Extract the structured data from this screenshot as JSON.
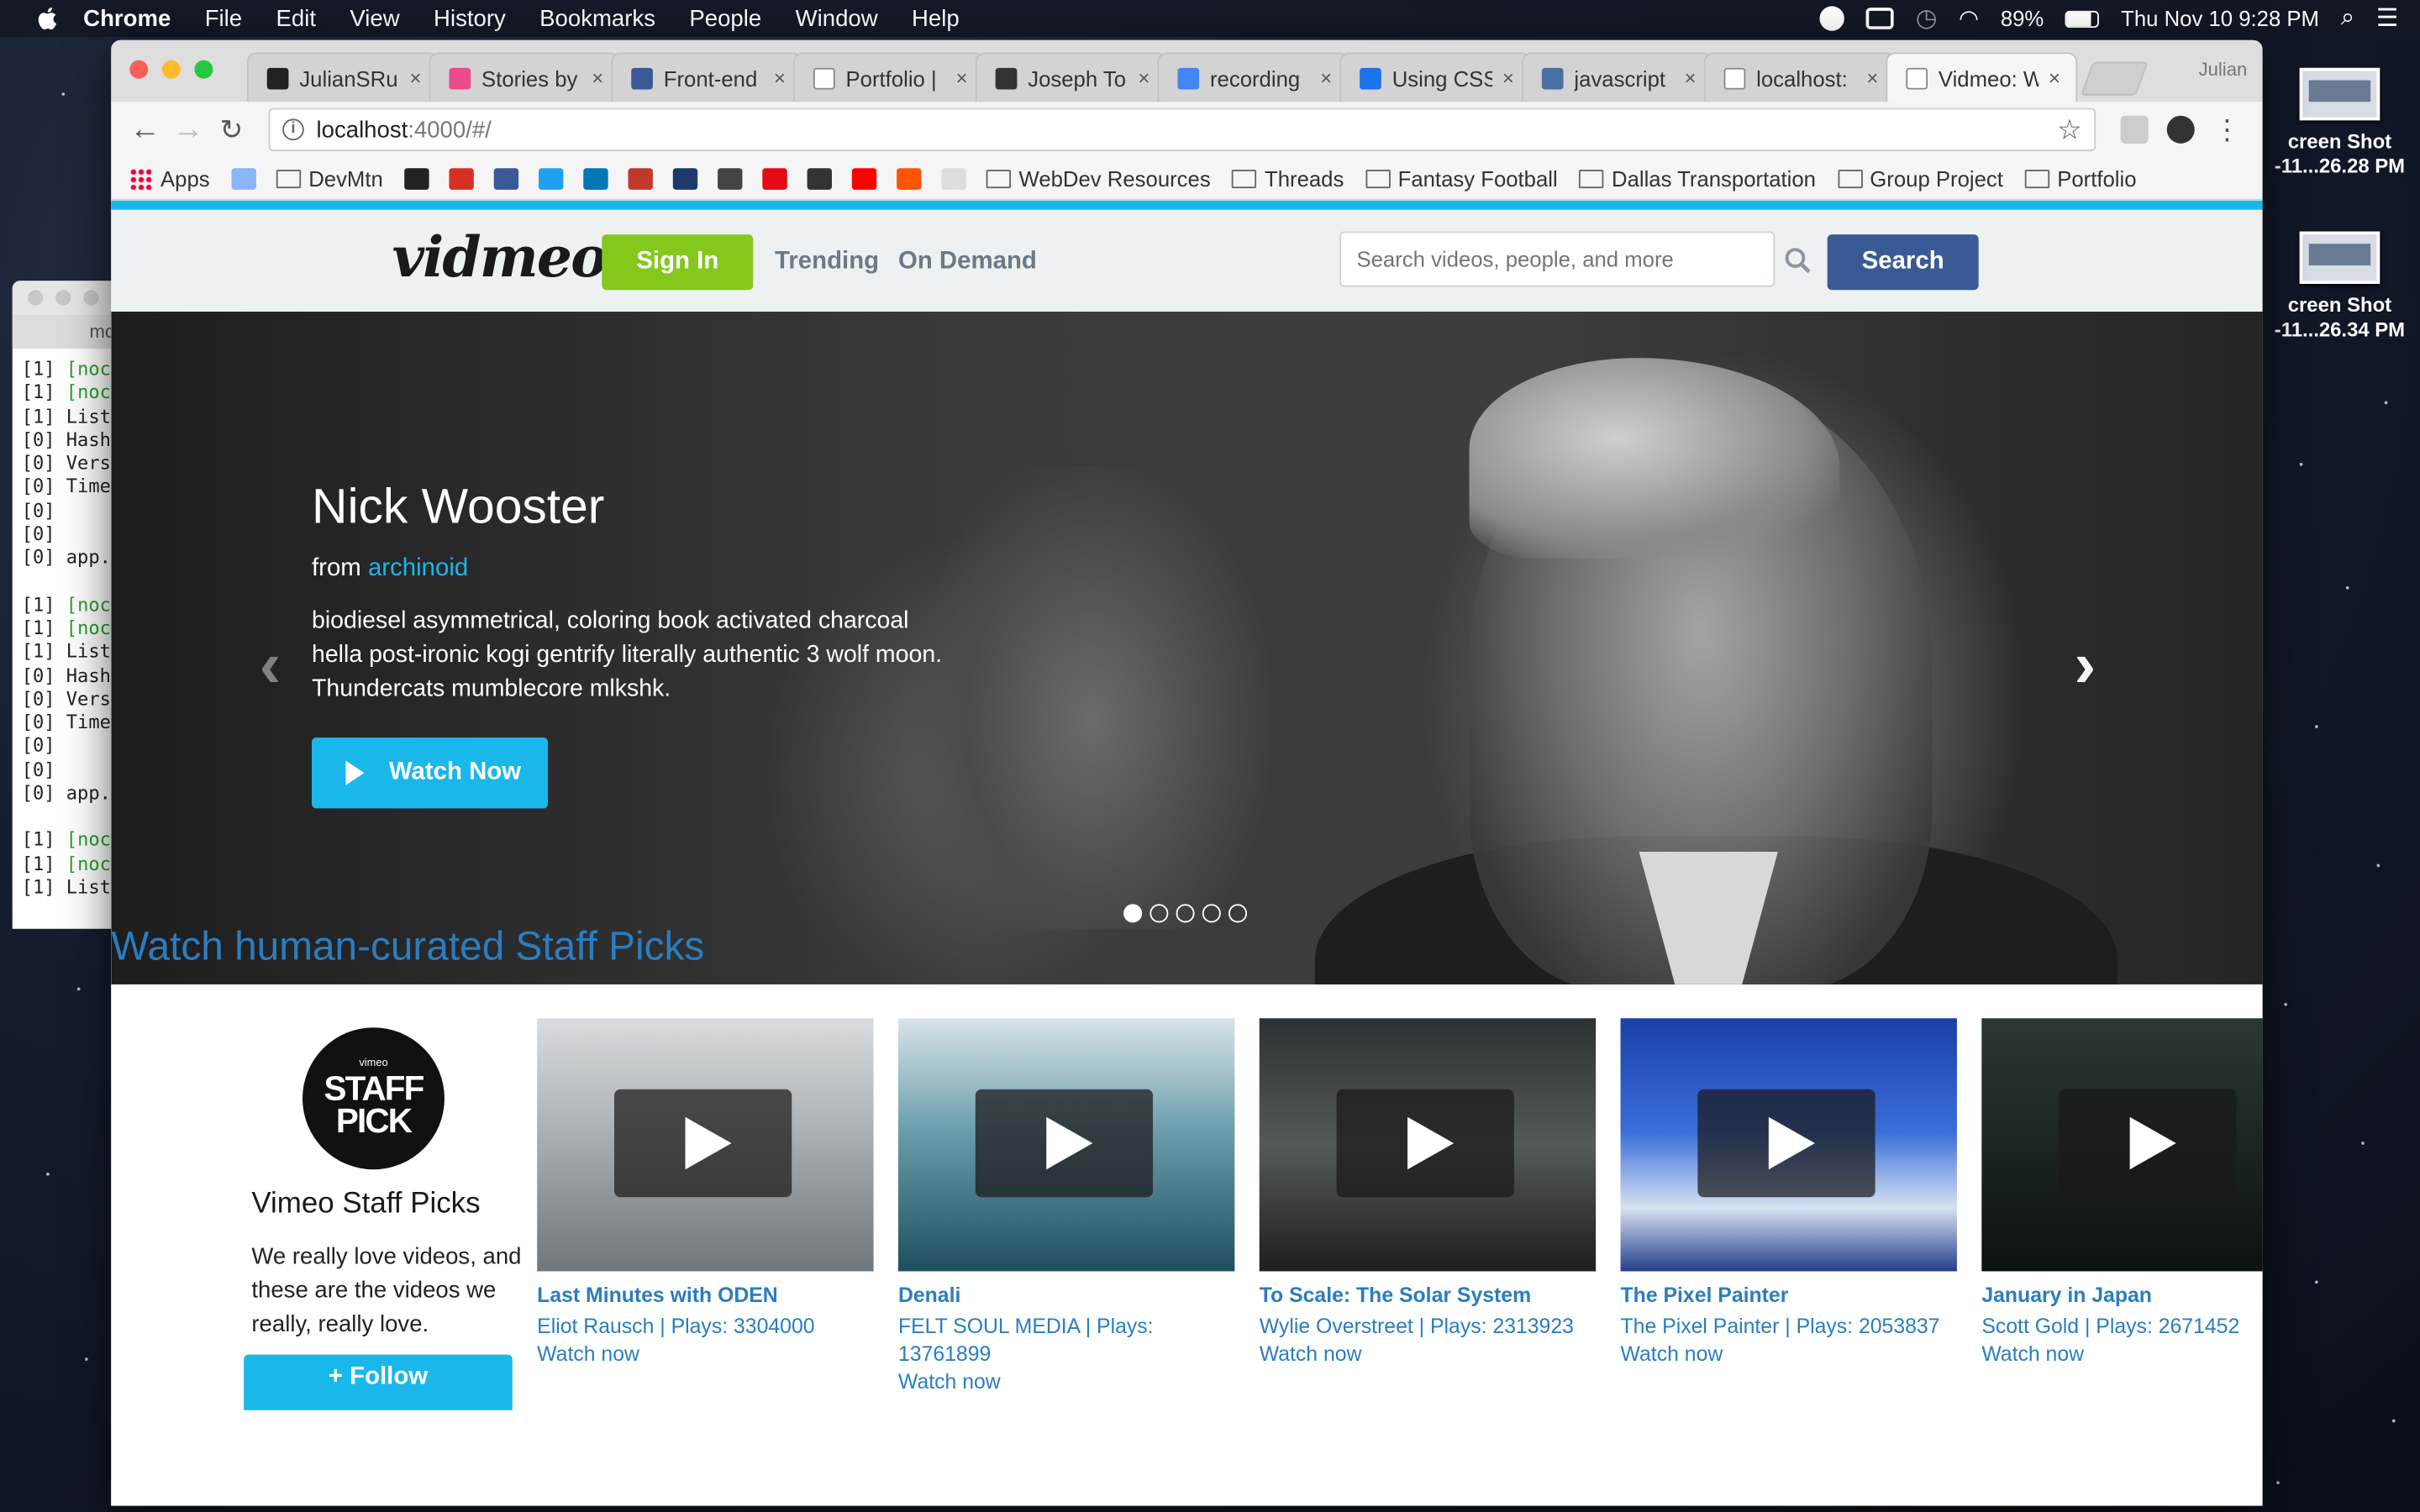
{
  "menubar": {
    "app": "Chrome",
    "items": [
      "File",
      "Edit",
      "View",
      "History",
      "Bookmarks",
      "People",
      "Window",
      "Help"
    ],
    "battery": "89%",
    "datetime": "Thu Nov 10  9:28 PM"
  },
  "desktop": {
    "icons": [
      {
        "line1": "creen Shot",
        "line2": "-11...26.28 PM"
      },
      {
        "line1": "creen Shot",
        "line2": "-11...26.34 PM"
      }
    ]
  },
  "terminal": {
    "tab": "mo",
    "lines": [
      {
        "t": "[1] ",
        "g": "[noc"
      },
      {
        "t": "[1] ",
        "g": "[noc"
      },
      {
        "t": "[1] List",
        "g": ""
      },
      {
        "t": "[0] Hash",
        "g": ""
      },
      {
        "t": "[0] Vers",
        "g": ""
      },
      {
        "t": "[0] Time",
        "g": ""
      },
      {
        "t": "[0]",
        "g": ""
      },
      {
        "t": "[0]",
        "g": ""
      },
      {
        "t": "[0] app.",
        "g": ""
      },
      {
        "t": "",
        "g": ""
      },
      {
        "t": "[1] ",
        "g": "[noc"
      },
      {
        "t": "[1] ",
        "g": "[noc"
      },
      {
        "t": "[1] List",
        "g": ""
      },
      {
        "t": "[0] Hash",
        "g": ""
      },
      {
        "t": "[0] Vers",
        "g": ""
      },
      {
        "t": "[0] Time",
        "g": ""
      },
      {
        "t": "[0]",
        "g": ""
      },
      {
        "t": "[0]",
        "g": ""
      },
      {
        "t": "[0] app.",
        "g": ""
      },
      {
        "t": "",
        "g": ""
      },
      {
        "t": "[1] ",
        "g": "[noc"
      },
      {
        "t": "[1] ",
        "g": "[noc"
      },
      {
        "t": "[1] List",
        "g": ""
      }
    ]
  },
  "browser": {
    "tabs": [
      {
        "title": "JulianSRu",
        "color": "#222222",
        "active": false
      },
      {
        "title": "Stories by",
        "color": "#ea4c89",
        "active": false
      },
      {
        "title": "Front-end",
        "color": "#3b5998",
        "active": false
      },
      {
        "title": "Portfolio |",
        "color": "#ffffff",
        "active": false
      },
      {
        "title": "Joseph To",
        "color": "#333333",
        "active": false
      },
      {
        "title": "recording",
        "color": "#4285f4",
        "active": false
      },
      {
        "title": "Using CSS",
        "color": "#1a73e8",
        "active": false
      },
      {
        "title": "javascript",
        "color": "#4a6fa5",
        "active": false
      },
      {
        "title": "localhost:",
        "color": "#ffffff",
        "active": false
      },
      {
        "title": "Vidmeo: W",
        "color": "#ffffff",
        "active": true
      }
    ],
    "profile": "Julian",
    "url_host": "localhost",
    "url_path": ":4000/#/",
    "bookmarks": [
      {
        "label": "Apps",
        "kind": "apps"
      },
      {
        "label": "",
        "kind": "icon",
        "color": "#8ab4f8"
      },
      {
        "label": "DevMtn",
        "kind": "folder"
      },
      {
        "label": "",
        "kind": "icon",
        "color": "#222222"
      },
      {
        "label": "",
        "kind": "icon",
        "color": "#d93025"
      },
      {
        "label": "",
        "kind": "icon",
        "color": "#3b5998"
      },
      {
        "label": "",
        "kind": "icon",
        "color": "#1da1f2"
      },
      {
        "label": "",
        "kind": "icon",
        "color": "#0077b5"
      },
      {
        "label": "",
        "kind": "icon",
        "color": "#c0392b"
      },
      {
        "label": "",
        "kind": "icon",
        "color": "#1b3a6b"
      },
      {
        "label": "",
        "kind": "icon",
        "color": "#444444"
      },
      {
        "label": "",
        "kind": "icon",
        "color": "#e50914"
      },
      {
        "label": "",
        "kind": "icon",
        "color": "#333333"
      },
      {
        "label": "",
        "kind": "icon",
        "color": "#ff0000"
      },
      {
        "label": "",
        "kind": "icon",
        "color": "#ff5500"
      },
      {
        "label": "",
        "kind": "icon",
        "color": "#dddddd"
      },
      {
        "label": "WebDev Resources",
        "kind": "folder"
      },
      {
        "label": "Threads",
        "kind": "folder"
      },
      {
        "label": "Fantasy Football",
        "kind": "folder"
      },
      {
        "label": "Dallas Transportation",
        "kind": "folder"
      },
      {
        "label": "Group Project",
        "kind": "folder"
      },
      {
        "label": "Portfolio",
        "kind": "folder"
      }
    ]
  },
  "site": {
    "logo": "vidmeo",
    "sign_in": "Sign In",
    "nav": [
      "Trending",
      "On Demand"
    ],
    "search_placeholder": "Search videos, people, and more",
    "search_button": "Search",
    "hero": {
      "title": "Nick Wooster",
      "from_label": "from",
      "from_user": "archinoid",
      "description": "biodiesel asymmetrical, coloring book activated charcoal hella post-ironic kogi gentrify literally authentic 3 wolf moon. Thundercats mumblecore mlkshk.",
      "watch_button": "Watch Now",
      "slides": 5,
      "active_slide": 1
    },
    "staff_picks": {
      "heading": "Watch human-curated Staff Picks",
      "badge_small": "vimeo",
      "badge_line1": "STAFF",
      "badge_line2": "PICK",
      "name": "Vimeo Staff Picks",
      "description": "We really love videos, and these are the videos we really, really love.",
      "follow": "+ Follow"
    },
    "videos": [
      {
        "title": "Last Minutes with ODEN",
        "meta": "Eliot Rausch | Plays: 3304000",
        "watch": "Watch now",
        "bg": "linear-gradient(180deg,#d9dde0 0%,#aab0b4 45%,#6f777c 100%)"
      },
      {
        "title": "Denali",
        "meta": "FELT SOUL MEDIA | Plays: 13761899",
        "watch": "Watch now",
        "bg": "linear-gradient(180deg,#d9e4e8 0%,#6a9cab 45%,#1f4f5e 100%)"
      },
      {
        "title": "To Scale: The Solar System",
        "meta": "Wylie Overstreet | Plays: 2313923",
        "watch": "Watch now",
        "bg": "linear-gradient(180deg,#2c3134 0%,#545a5c 50%,#1c1e20 100%)"
      },
      {
        "title": "The Pixel Painter",
        "meta": "The Pixel Painter | Plays: 2053837",
        "watch": "Watch now",
        "bg": "linear-gradient(180deg,#1a3fa8 0%,#3a6ed8 45%,#d7e2f2 75%,#243d8a 100%)"
      },
      {
        "title": "January in Japan",
        "meta": "Scott Gold | Plays: 2671452",
        "watch": "Watch now",
        "bg": "linear-gradient(180deg,#2a3834 0%,#17211f 60%,#0c1110 100%)"
      }
    ]
  }
}
